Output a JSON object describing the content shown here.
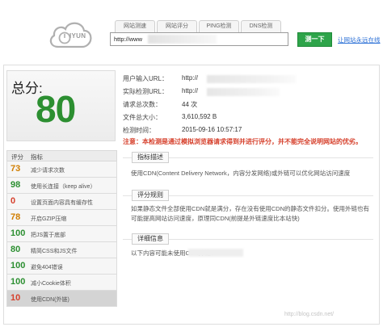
{
  "header": {
    "logo_text": "IYUN",
    "tabs": [
      "网站测速",
      "网站评分",
      "PING检测",
      "DNS检测"
    ],
    "url_value": "http://www",
    "test_button": "测一下",
    "other_link": "让网站永远在线"
  },
  "score": {
    "title": "总分:",
    "value": "80"
  },
  "info": [
    {
      "label": "用户输入URL：",
      "value": "http://"
    },
    {
      "label": "实际检测URL：",
      "value": "http://"
    },
    {
      "label": "请求总次数：",
      "value": "44 次"
    },
    {
      "label": "文件总大小：",
      "value": "3,610,592 B"
    },
    {
      "label": "检测时间：",
      "value": "2015-09-16 10:57:17"
    }
  ],
  "notice": "注意：本检测是通过模拟浏览器请求得到并进行评分，并不能完全说明网站的优劣。",
  "list": {
    "headers": [
      "评分",
      "指标"
    ],
    "items": [
      {
        "score": "73",
        "label": "减少请求次数",
        "color": "#d07d00"
      },
      {
        "score": "98",
        "label": "使用长连接（keep alive）",
        "color": "#2c8f31"
      },
      {
        "score": "0",
        "label": "设置页面内容具有缓存性",
        "color": "#d6402c"
      },
      {
        "score": "78",
        "label": "开启GZIP压缩",
        "color": "#d07d00"
      },
      {
        "score": "100",
        "label": "把JS置于底部",
        "color": "#2c8f31"
      },
      {
        "score": "80",
        "label": "精简CSS和JS文件",
        "color": "#2c8f31"
      },
      {
        "score": "100",
        "label": "避免404错误",
        "color": "#2c8f31"
      },
      {
        "score": "100",
        "label": "减小Cookie体积",
        "color": "#2c8f31"
      },
      {
        "score": "10",
        "label": "使用CDN(外链)",
        "color": "#d6402c"
      }
    ]
  },
  "sections": {
    "indicator_title": "指标描述",
    "indicator_text": "使用CDN(Content Delivery Network，内容分发网络)或外链可以优化网站访问速度",
    "rule_title": "评分规则",
    "rule_text": "如果静态文件全部使用CDN就是满分，存在没有使用CDN的静态文件扣分。使用外链也有可能提高网站访问速度，原理同CDN(前提是外链速度比本站快)",
    "detail_title": "详细信息",
    "detail_text": "以下内容可能未使用CDN外链："
  },
  "watermark": "http://blog.csdn.net/"
}
